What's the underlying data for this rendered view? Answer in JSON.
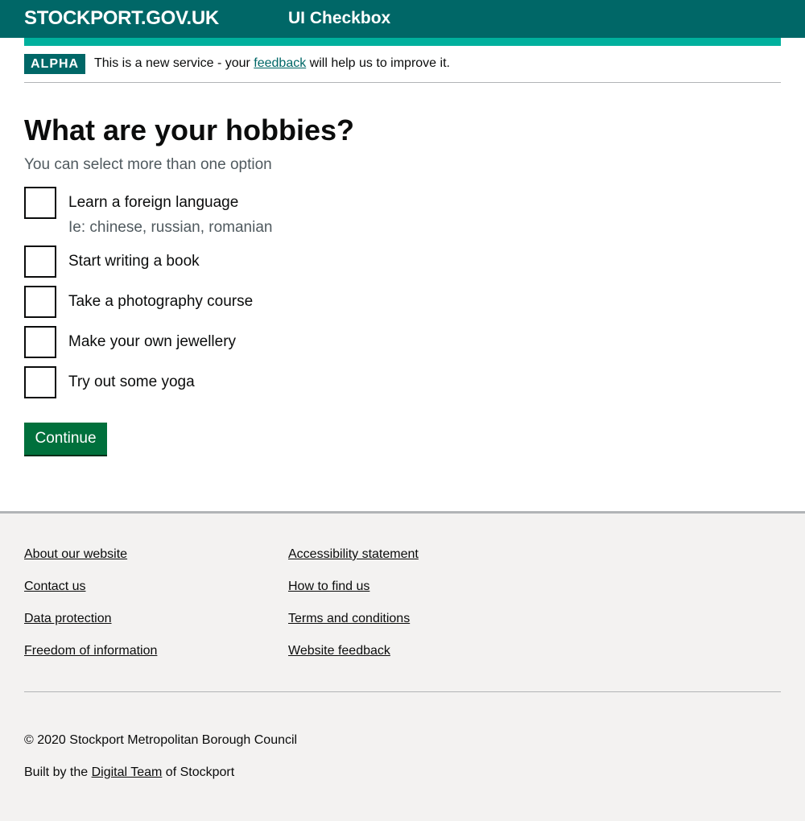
{
  "header": {
    "logo": "STOCKPORT.GOV.UK",
    "service_name": "UI Checkbox",
    "brand_color": "#006767",
    "accent_color": "#00b09d"
  },
  "phase_banner": {
    "tag": "ALPHA",
    "text_before": "This is a new service - your ",
    "link": "feedback",
    "text_after": " will help us to improve it."
  },
  "main": {
    "title": "What are your hobbies?",
    "hint": "You can select more than one option",
    "options": [
      {
        "label": "Learn a foreign language",
        "hint": "Ie: chinese, russian, romanian",
        "checked": false
      },
      {
        "label": "Start writing a book",
        "checked": false
      },
      {
        "label": "Take a photography course",
        "checked": false
      },
      {
        "label": "Make your own jewellery",
        "checked": false
      },
      {
        "label": "Try out some yoga",
        "checked": false
      }
    ],
    "continue_label": "Continue"
  },
  "footer": {
    "links_left": [
      "About our website",
      "Contact us",
      "Data protection",
      "Freedom of information"
    ],
    "links_right": [
      "Accessibility statement",
      "How to find us",
      "Terms and conditions",
      "Website feedback"
    ],
    "copyright": "© 2020 Stockport Metropolitan Borough Council",
    "built_before": "Built by the ",
    "built_link": "Digital Team",
    "built_after": " of Stockport"
  }
}
